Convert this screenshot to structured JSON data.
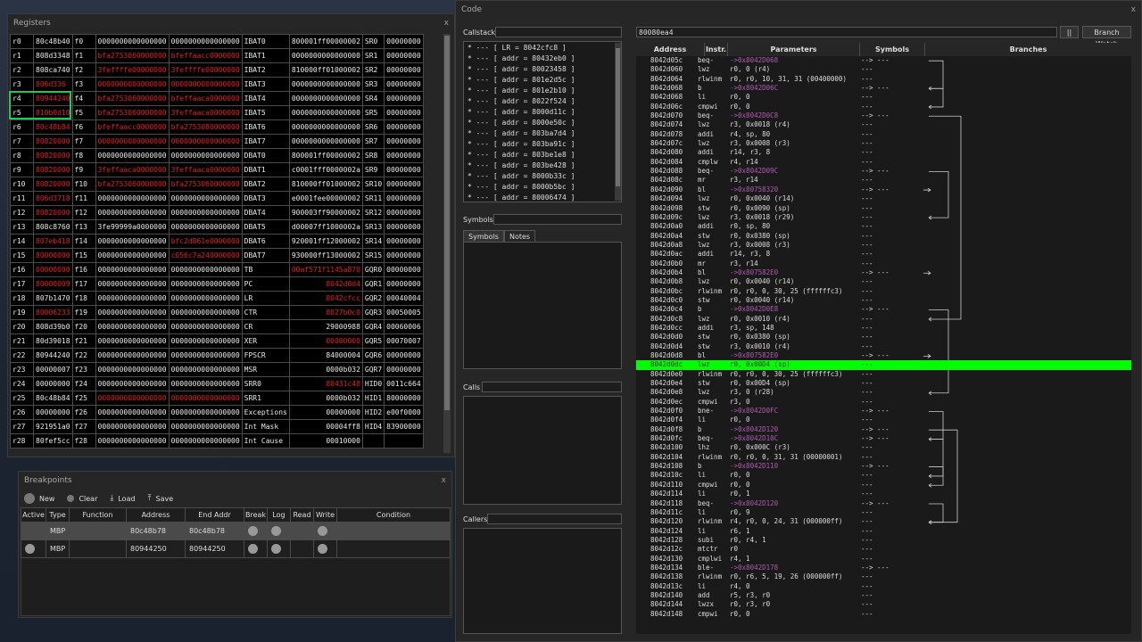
{
  "registers_window": {
    "title": "Registers",
    "close": "x",
    "rows": [
      [
        "r0",
        "80c48b40",
        "f0",
        "0000000000000000",
        "0000000000000000",
        "IBAT0",
        "800001ff00000002",
        "SR0",
        "00000000"
      ],
      [
        "r1",
        "808d3348",
        "f1",
        "bfa2753060000000",
        "bfeffaacc0000000",
        "IBAT1",
        "0000000000000000",
        "SR1",
        "00000000"
      ],
      [
        "r2",
        "808ca740",
        "f2",
        "3feffffe00000000",
        "3feffffe00000000",
        "IBAT2",
        "810000ff01000002",
        "SR2",
        "00000000"
      ],
      [
        "r3",
        "806d336",
        "f3",
        "0000000000000000",
        "0000000000000000",
        "IBAT3",
        "0000000000000000",
        "SR3",
        "00000000"
      ],
      [
        "r4",
        "80944240",
        "f4",
        "bfa2753060000000",
        "bfeffaaca0000000",
        "IBAT4",
        "0000000000000000",
        "SR4",
        "00000000"
      ],
      [
        "r5",
        "810b0d10",
        "f5",
        "bfa2753060000000",
        "3feffaaca0000000",
        "IBAT5",
        "0000000000000000",
        "SR5",
        "00000000"
      ],
      [
        "r6",
        "80c48b84",
        "f6",
        "bfeffaacc0000000",
        "bfa2753080000000",
        "IBAT6",
        "0000000000000000",
        "SR6",
        "00000000"
      ],
      [
        "r7",
        "80820000",
        "f7",
        "0000000000000000",
        "0000000000000000",
        "IBAT7",
        "0000000000000000",
        "SR7",
        "00000000"
      ],
      [
        "r8",
        "80820000",
        "f8",
        "0000000000000000",
        "0000000000000000",
        "DBAT0",
        "800001ff00000002",
        "SR8",
        "00000000"
      ],
      [
        "r9",
        "80820000",
        "f9",
        "3feffaaca0000000",
        "3feffaaca0000000",
        "DBAT1",
        "c0001fff0000002a",
        "SR9",
        "00000000"
      ],
      [
        "r10",
        "80820000",
        "f10",
        "bfa2753060000000",
        "bfa2753060000000",
        "DBAT2",
        "810000ff01000002",
        "SR10",
        "00000000"
      ],
      [
        "r11",
        "806d3718",
        "f11",
        "0000000000000000",
        "0000000000000000",
        "DBAT3",
        "e0001fee00000002",
        "SR11",
        "00000000"
      ],
      [
        "r12",
        "80820000",
        "f12",
        "0000000000000000",
        "0000000000000000",
        "DBAT4",
        "900003ff90000002",
        "SR12",
        "00000000"
      ],
      [
        "r13",
        "808c8760",
        "f13",
        "3fe99999a0000000",
        "0000000000000000",
        "DBAT5",
        "d00007ff1000002a",
        "SR13",
        "00000000"
      ],
      [
        "r14",
        "807eb418",
        "f14",
        "0000000000000000",
        "bfc2d861e0000000",
        "DBAT6",
        "920001ff12000002",
        "SR14",
        "00000000"
      ],
      [
        "r15",
        "80000000",
        "f15",
        "0000000000000000",
        "c056c7a240000000",
        "DBAT7",
        "930000ff13000002",
        "SR15",
        "00000000"
      ],
      [
        "r16",
        "00000000",
        "f16",
        "0000000000000000",
        "0000000000000000",
        "TB",
        "00af571f1145a870",
        "GQR0",
        "00000000"
      ],
      [
        "r17",
        "80000009",
        "f17",
        "0000000000000000",
        "0000000000000000",
        "PC",
        "8042d0d4",
        "GQR1",
        "00000000"
      ],
      [
        "r18",
        "807b1470",
        "f18",
        "0000000000000000",
        "0000000000000000",
        "LR",
        "8042cfcc",
        "GQR2",
        "00040004"
      ],
      [
        "r19",
        "80006233",
        "f19",
        "0000000000000000",
        "0000000000000000",
        "CTR",
        "8027b0c0",
        "GQR3",
        "00050005"
      ],
      [
        "r20",
        "808d39b0",
        "f20",
        "0000000000000000",
        "0000000000000000",
        "CR",
        "29000988",
        "GQR4",
        "00060006"
      ],
      [
        "r21",
        "80d39018",
        "f21",
        "0000000000000000",
        "0000000000000000",
        "XER",
        "00000000",
        "GQR5",
        "00070007"
      ],
      [
        "r22",
        "80944240",
        "f22",
        "0000000000000000",
        "0000000000000000",
        "FPSCR",
        "84000004",
        "GQR6",
        "00000000"
      ],
      [
        "r23",
        "00000007",
        "f23",
        "0000000000000000",
        "0000000000000000",
        "MSR",
        "0000b032",
        "GQR7",
        "00000000"
      ],
      [
        "r24",
        "00000000",
        "f24",
        "0000000000000000",
        "0000000000000000",
        "SRR0",
        "80431c48",
        "HID0",
        "0011c664"
      ],
      [
        "r25",
        "80c48b84",
        "f25",
        "0000000000000000",
        "0000000000000000",
        "SRR1",
        "0000b032",
        "HID1",
        "80000000"
      ],
      [
        "r26",
        "00000000",
        "f26",
        "0000000000000000",
        "0000000000000000",
        "Exceptions",
        "00000000",
        "HID2",
        "e00f0000"
      ],
      [
        "r27",
        "921951a0",
        "f27",
        "0000000000000000",
        "0000000000000000",
        "Int Mask",
        "00004ff8",
        "HID4",
        "83900000"
      ],
      [
        "r28",
        "80fef5cc",
        "f28",
        "0000000000000000",
        "0000000000000000",
        "Int Cause",
        "00010000",
        "",
        ""
      ]
    ]
  },
  "breakpoints_window": {
    "title": "Breakpoints",
    "close": "x",
    "toolbar": {
      "new": "New",
      "clear": "Clear",
      "load": "Load",
      "save": "Save"
    },
    "columns": [
      "Active",
      "Type",
      "Function",
      "Address",
      "End Addr",
      "Break",
      "Log",
      "Read",
      "Write",
      "Condition"
    ],
    "rows": [
      {
        "type": "MBP",
        "function": "",
        "address": "80c48b78",
        "end": "80c48b78"
      },
      {
        "type": "MBP",
        "function": "",
        "address": "80944250",
        "end": "80944250"
      }
    ]
  },
  "code_window": {
    "title": "Code",
    "close": "x",
    "callstack_label": "Callstack",
    "callstack": [
      "* --- [ LR = 8042cfc8 ]",
      "* --- [ addr = 80432eb0 ]",
      "* --- [ addr = 80023458 ]",
      "* --- [ addr = 801e2d5c ]",
      "* --- [ addr = 801e2b10 ]",
      "* --- [ addr = 8022f524 ]",
      "* --- [ addr = 8000d11c ]",
      "* --- [ addr = 8000e50c ]",
      "* --- [ addr = 803ba7d4 ]",
      "* --- [ addr = 803ba91c ]",
      "* --- [ addr = 803be1e8 ]",
      "* --- [ addr = 803be428 ]",
      "* --- [ addr = 8000b33c ]",
      "* --- [ addr = 8000b5bc ]",
      "* --- [ addr = 80006474 ]"
    ],
    "symbols_label": "Symbols",
    "tabs": [
      "Symbols",
      "Notes"
    ],
    "calls_label": "Calls",
    "callers_label": "Callers",
    "address_input": "80080ea4",
    "pause_button": "||",
    "branch_watch_button": "Branch Watch",
    "columns": [
      "Address",
      "Instr.",
      "Parameters",
      "Symbols",
      "Branches"
    ],
    "current_row": 33,
    "rows": [
      [
        "8042d05c",
        "beq-",
        "->0x8042D068",
        "-->  ---",
        1
      ],
      [
        "8042d060",
        "lwz",
        "r0, 0 (r4)",
        "---",
        0
      ],
      [
        "8042d064",
        "rlwinm",
        "r0, r0, 10, 31, 31 (00400000)",
        "---",
        0
      ],
      [
        "8042d068",
        "b",
        "->0x8042D06C",
        "-->  ---",
        1
      ],
      [
        "8042d068",
        "li",
        "r0, 0",
        "---",
        0
      ],
      [
        "8042d06c",
        "cmpwi",
        "r0, 0",
        "---",
        0
      ],
      [
        "8042d070",
        "beq-",
        "->0x8042D0C8",
        "-->  ---",
        1
      ],
      [
        "8042d074",
        "lwz",
        "r3, 0x0018 (r4)",
        "---",
        0
      ],
      [
        "8042d078",
        "addi",
        "r4, sp, 80",
        "---",
        0
      ],
      [
        "8042d07c",
        "lwz",
        "r3, 0x0008 (r3)",
        "---",
        0
      ],
      [
        "8042d080",
        "addi",
        "r14, r3, 8",
        "---",
        0
      ],
      [
        "8042d084",
        "cmplw",
        "r4, r14",
        "---",
        0
      ],
      [
        "8042d088",
        "beq-",
        "->0x8042D09C",
        "-->  ---",
        1
      ],
      [
        "8042d08c",
        "mr",
        "r3, r14",
        "---",
        0
      ],
      [
        "8042d090",
        "bl",
        "->0x80758320",
        "-->  ---",
        1
      ],
      [
        "8042d094",
        "lwz",
        "r0, 0x0040 (r14)",
        "---",
        0
      ],
      [
        "8042d098",
        "stw",
        "r0, 0x0090 (sp)",
        "---",
        0
      ],
      [
        "8042d09c",
        "lwz",
        "r3, 0x0018 (r29)",
        "---",
        0
      ],
      [
        "8042d0a0",
        "addi",
        "r0, sp, 80",
        "---",
        0
      ],
      [
        "8042d0a4",
        "stw",
        "r0, 0x0380 (sp)",
        "---",
        0
      ],
      [
        "8042d0a8",
        "lwz",
        "r3, 0x0008 (r3)",
        "---",
        0
      ],
      [
        "8042d0ac",
        "addi",
        "r14, r3, 8",
        "---",
        0
      ],
      [
        "8042d0b0",
        "mr",
        "r3, r14",
        "---",
        0
      ],
      [
        "8042d0b4",
        "bl",
        "->0x807582E0",
        "-->  ---",
        1
      ],
      [
        "8042d0b8",
        "lwz",
        "r0, 0x0040 (r14)",
        "---",
        0
      ],
      [
        "8042d0bc",
        "rlwinm",
        "r0, r0, 0, 30, 25 (ffffffc3)",
        "---",
        0
      ],
      [
        "8042d0c0",
        "stw",
        "r0, 0x0040 (r14)",
        "---",
        0
      ],
      [
        "8042d0c4",
        "b",
        "->0x8042D0E8",
        "-->  ---",
        1
      ],
      [
        "8042d0c8",
        "lwz",
        "r0, 0x0010 (r4)",
        "---",
        0
      ],
      [
        "8042d0cc",
        "addi",
        "r3, sp, 148",
        "---",
        0
      ],
      [
        "8042d0d0",
        "stw",
        "r0, 0x0380 (sp)",
        "---",
        0
      ],
      [
        "8042d0d4",
        "stw",
        "r3, 0x0010 (r4)",
        "---",
        0
      ],
      [
        "8042d0d8",
        "bl",
        "->0x807582E0",
        "-->  ---",
        1
      ],
      [
        "8042d0dc",
        "lwz",
        "r0, 0x00D4 (sp)",
        "---",
        0
      ],
      [
        "8042d0e0",
        "rlwinm",
        "r0, r0, 0, 30, 25 (ffffffc3)",
        "---",
        0
      ],
      [
        "8042d0e4",
        "stw",
        "r0, 0x00D4 (sp)",
        "---",
        0
      ],
      [
        "8042d0e8",
        "lwz",
        "r3, 0 (r28)",
        "---",
        0
      ],
      [
        "8042d0ec",
        "cmpwi",
        "r3, 0",
        "---",
        0
      ],
      [
        "8042d0f0",
        "bne-",
        "->0x8042D0FC",
        "-->  ---",
        1
      ],
      [
        "8042d0f4",
        "li",
        "r0, 0",
        "---",
        0
      ],
      [
        "8042d0f8",
        "b",
        "->0x8042D120",
        "-->  ---",
        1
      ],
      [
        "8042d0fc",
        "beq-",
        "->0x8042D10C",
        "-->  ---",
        1
      ],
      [
        "8042d100",
        "lhz",
        "r0, 0x000C (r3)",
        "---",
        0
      ],
      [
        "8042d104",
        "rlwinm",
        "r0, r0, 0, 31, 31 (00000001)",
        "---",
        0
      ],
      [
        "8042d108",
        "b",
        "->0x8042D110",
        "-->  ---",
        1
      ],
      [
        "8042d10c",
        "li",
        "r0, 0",
        "---",
        0
      ],
      [
        "8042d110",
        "cmpwi",
        "r0, 0",
        "---",
        0
      ],
      [
        "8042d114",
        "li",
        "r0, 1",
        "---",
        0
      ],
      [
        "8042d118",
        "beq-",
        "->0x8042D120",
        "-->  ---",
        1
      ],
      [
        "8042d11c",
        "li",
        "r0, 9",
        "---",
        0
      ],
      [
        "8042d120",
        "rlwinm",
        "r4, r0, 0, 24, 31 (000000ff)",
        "---",
        0
      ],
      [
        "8042d124",
        "li",
        "r6, 1",
        "---",
        0
      ],
      [
        "8042d128",
        "subi",
        "r0, r4, 1",
        "---",
        0
      ],
      [
        "8042d12c",
        "mtctr",
        "r0",
        "---",
        0
      ],
      [
        "8042d130",
        "cmplwi",
        "r4, 1",
        "---",
        0
      ],
      [
        "8042d134",
        "ble-",
        "->0x8042D178",
        "-->  ---",
        1
      ],
      [
        "8042d138",
        "rlwinm",
        "r0, r6, 5, 19, 26 (000000ff)",
        "---",
        0
      ],
      [
        "8042d13c",
        "li",
        "r4, 0",
        "---",
        0
      ],
      [
        "8042d140",
        "add",
        "r5, r3, r0",
        "---",
        0
      ],
      [
        "8042d144",
        "lwzx",
        "r0, r3, r0",
        "---",
        0
      ],
      [
        "8042d148",
        "cmpwi",
        "r0, 0",
        "---",
        0
      ]
    ]
  },
  "colors": {
    "highlight": "#00ff00",
    "red_value": "#dd2222",
    "branch_target": "#b05ab0",
    "selection_box": "#22c55e"
  }
}
